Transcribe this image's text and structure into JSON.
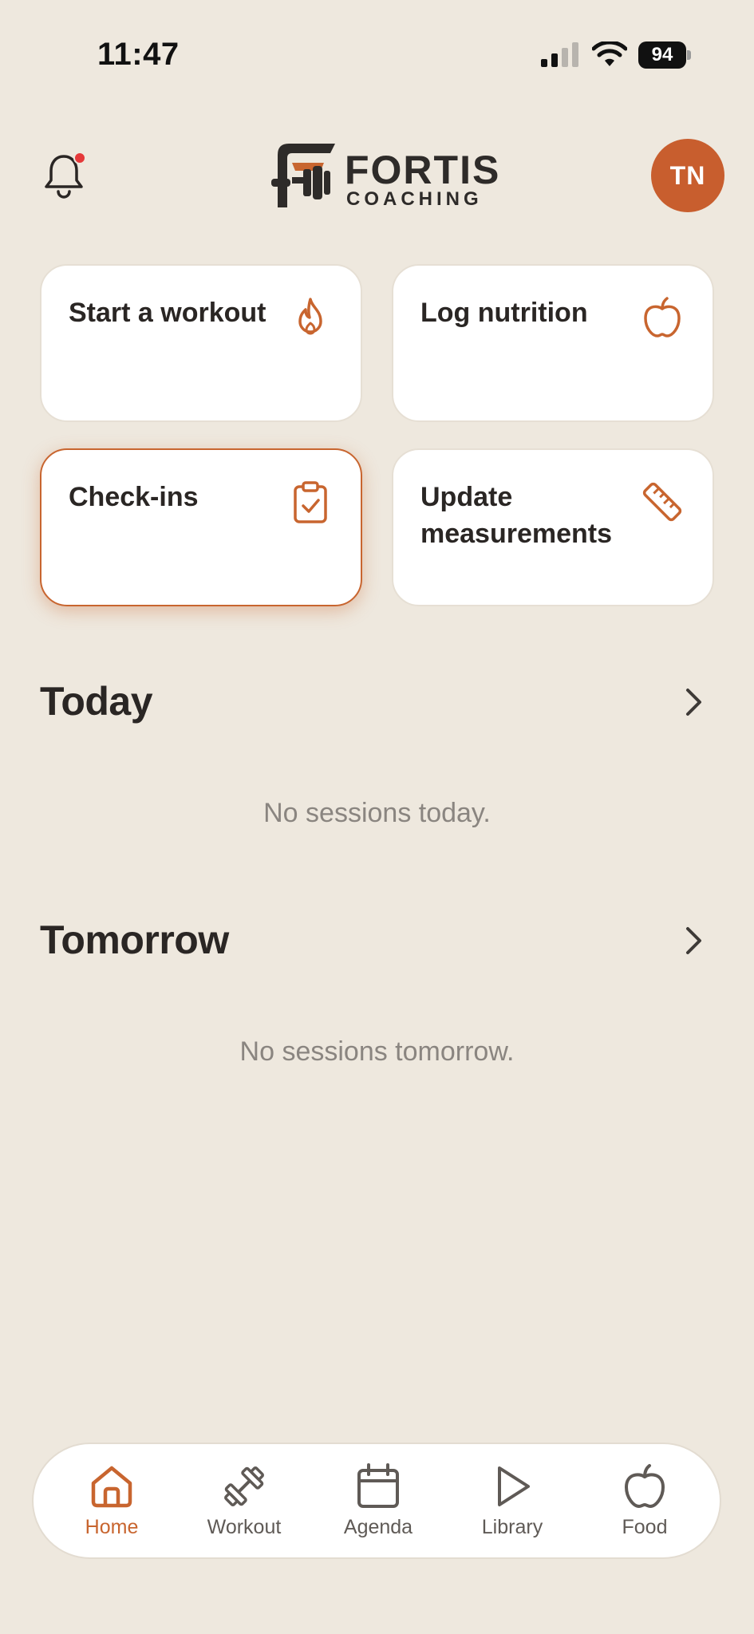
{
  "status_bar": {
    "time": "11:47",
    "battery": "94",
    "signal_icon": "cellular-signal-icon",
    "wifi_icon": "wifi-icon"
  },
  "header": {
    "logo_line1": "FORTIS",
    "logo_line2": "COACHING",
    "avatar_initials": "TN",
    "notification_icon": "bell-icon",
    "has_notification": true
  },
  "quick_actions": [
    {
      "label": "Start a workout",
      "icon": "flame-icon"
    },
    {
      "label": "Log nutrition",
      "icon": "apple-icon"
    },
    {
      "label": "Check-ins",
      "icon": "clipboard-check-icon",
      "highlighted": true
    },
    {
      "label": "Update measurements",
      "icon": "ruler-icon"
    }
  ],
  "sections": {
    "today": {
      "title": "Today",
      "empty_text": "No sessions today."
    },
    "tomorrow": {
      "title": "Tomorrow",
      "empty_text": "No sessions tomorrow."
    }
  },
  "tabbar": {
    "items": [
      {
        "label": "Home",
        "icon": "home-icon",
        "active": true
      },
      {
        "label": "Workout",
        "icon": "dumbbell-icon"
      },
      {
        "label": "Agenda",
        "icon": "calendar-icon"
      },
      {
        "label": "Library",
        "icon": "play-icon"
      },
      {
        "label": "Food",
        "icon": "apple-icon"
      }
    ]
  },
  "colors": {
    "background": "#EEE8DE",
    "accent": "#C8652F",
    "avatar": "#C85E2E",
    "notification_dot": "#E5393A"
  }
}
